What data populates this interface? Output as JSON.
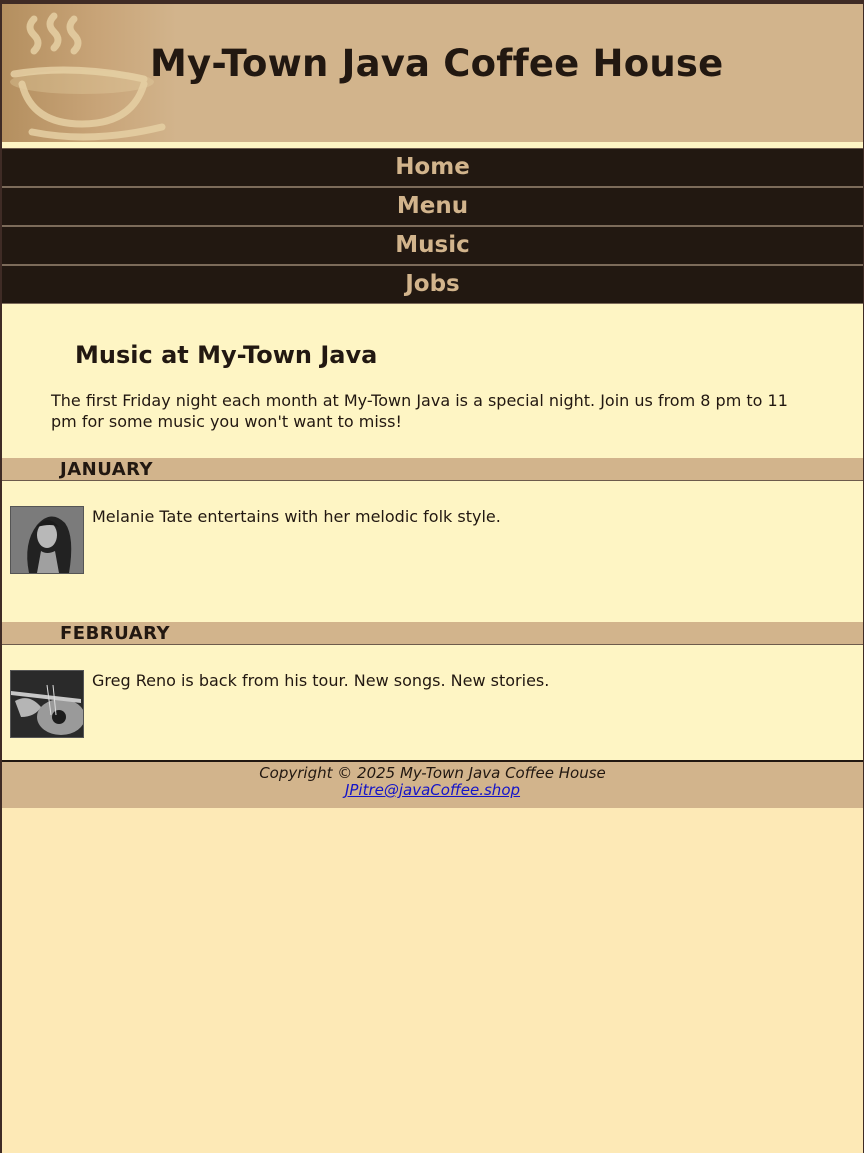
{
  "header": {
    "title": "My-Town Java Coffee House"
  },
  "nav": {
    "items": [
      "Home",
      "Menu",
      "Music",
      "Jobs"
    ]
  },
  "main": {
    "heading": "Music at My-Town Java",
    "intro": "The first Friday night each month at My-Town Java is a special night. Join us from 8 pm to 11 pm for some music you won't want to miss!",
    "months": [
      {
        "name": "JANUARY",
        "description": "Melanie Tate entertains with her melodic folk style."
      },
      {
        "name": "FEBRUARY",
        "description": "Greg Reno is back from his tour. New songs. New stories."
      }
    ]
  },
  "footer": {
    "copyright": "Copyright © 2025 My-Town Java Coffee House",
    "email": "JPitre@javaCoffee.shop"
  },
  "colors": {
    "header_bg": "#d2b48c",
    "nav_bg": "#221811",
    "nav_text": "#d2b48c",
    "content_bg": "#fef5c4",
    "page_bg": "#fde9b6",
    "text": "#221811",
    "link": "#1414c8"
  }
}
